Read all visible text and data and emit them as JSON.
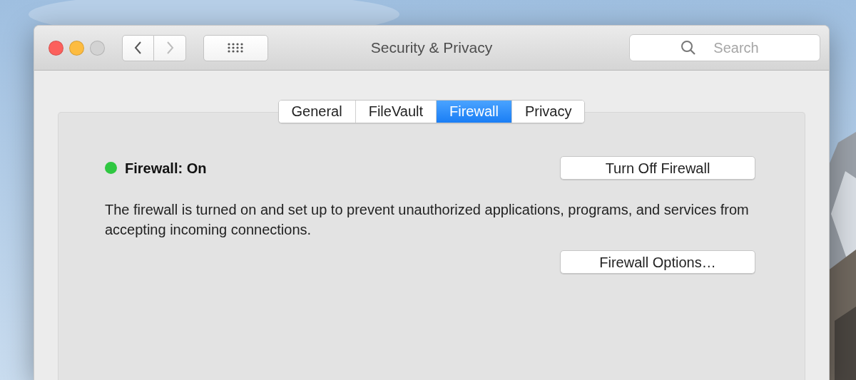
{
  "window": {
    "title": "Security & Privacy",
    "traffic_lights": [
      {
        "color": "#fc605c"
      },
      {
        "color": "#fdbc40"
      },
      {
        "color": "#d3d3d3"
      }
    ],
    "nav": [
      {
        "kind": "back",
        "disabled": false
      },
      {
        "kind": "forward",
        "disabled": true
      }
    ],
    "search": {
      "placeholder": "Search"
    }
  },
  "tabs": [
    {
      "label": "General",
      "selected": false
    },
    {
      "label": "FileVault",
      "selected": false
    },
    {
      "label": "Firewall",
      "selected": true
    },
    {
      "label": "Privacy",
      "selected": false
    }
  ],
  "status": {
    "label": "Firewall: On",
    "color": "#2fc741"
  },
  "toggle_button": "Turn Off Firewall",
  "description": "The firewall is turned on and set up to prevent unauthorized applications, programs, and services from accepting incoming connections.",
  "options_button": "Firewall Options…"
}
